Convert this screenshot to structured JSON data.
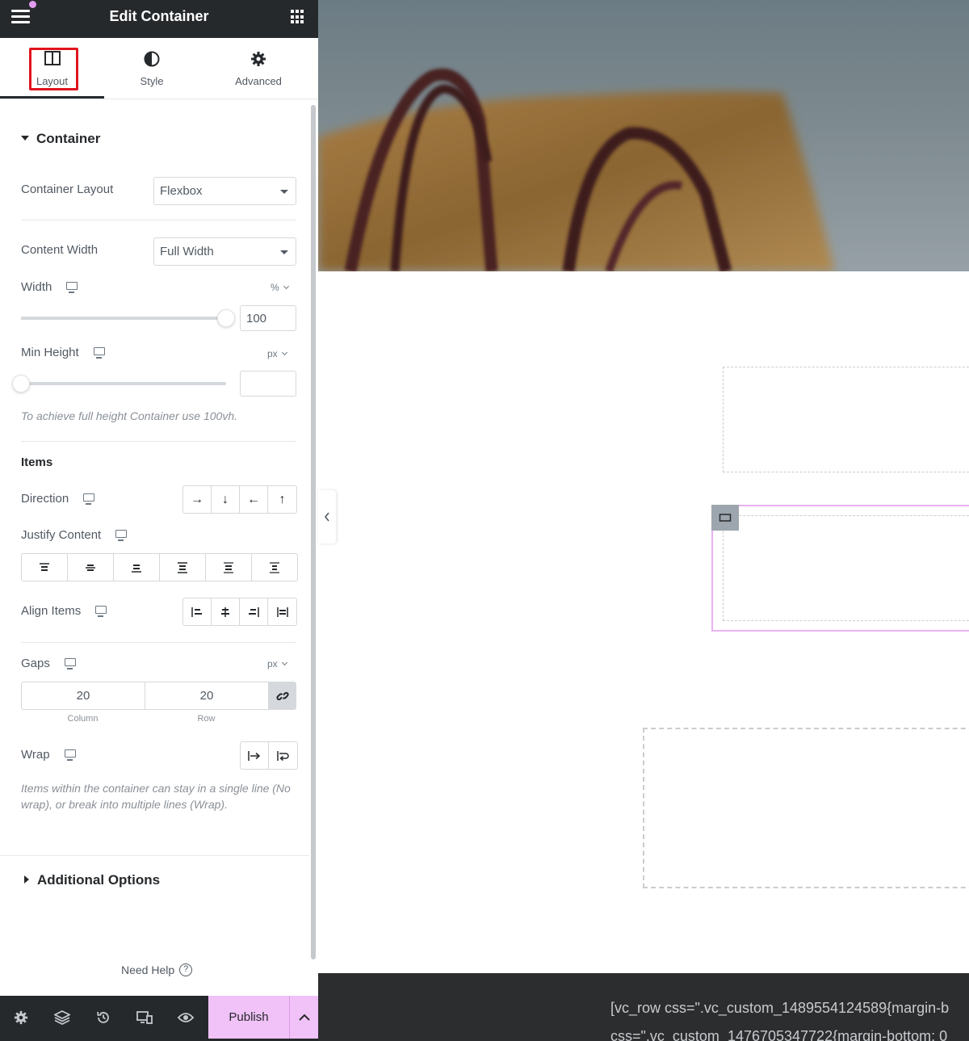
{
  "panel": {
    "title": "Edit Container",
    "tabs": [
      {
        "label": "Layout",
        "icon": "columns-icon",
        "active": true
      },
      {
        "label": "Style",
        "icon": "half-circle-icon"
      },
      {
        "label": "Advanced",
        "icon": "gear-icon"
      }
    ],
    "container_section": {
      "heading": "Container",
      "container_layout": {
        "label": "Container Layout",
        "value": "Flexbox"
      },
      "content_width": {
        "label": "Content Width",
        "value": "Full Width"
      },
      "width": {
        "label": "Width",
        "unit": "%",
        "value": "100",
        "slider_fraction": 1.0
      },
      "min_height": {
        "label": "Min Height",
        "unit": "px",
        "value": "",
        "slider_fraction": 0.0
      },
      "min_height_note": "To achieve full height Container use 100vh."
    },
    "items_section": {
      "heading": "Items",
      "direction": {
        "label": "Direction",
        "options": [
          "→",
          "↓",
          "←",
          "↑"
        ]
      },
      "justify_content": {
        "label": "Justify Content"
      },
      "align_items": {
        "label": "Align Items"
      },
      "gaps": {
        "label": "Gaps",
        "unit": "px",
        "column": "20",
        "row": "20",
        "column_label": "Column",
        "row_label": "Row"
      },
      "wrap": {
        "label": "Wrap",
        "note": "Items within the container can stay in a single line (No wrap), or break into multiple lines (Wrap)."
      }
    },
    "additional_options": "Additional Options",
    "need_help": "Need Help",
    "footer": {
      "icons": [
        "gear-icon",
        "layers-icon",
        "history-icon",
        "responsive-icon",
        "eye-icon"
      ],
      "publish": "Publish"
    }
  },
  "preview": {
    "code_line1": "[vc_row css=\".vc_custom_1489554124589{margin-b",
    "code_line2": "css=\".vc_custom_1476705347722{margin-bottom: 0"
  },
  "colors": {
    "topbar": "#26292c",
    "accent_pink": "#f0c2f7",
    "highlight_red": "#e0141e"
  }
}
